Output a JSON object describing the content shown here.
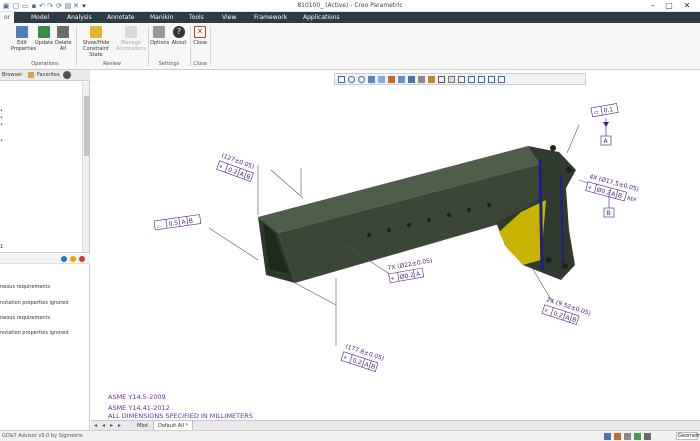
{
  "window": {
    "title": "810100_ (Active) - Creo Parametric"
  },
  "menu": {
    "tabs": [
      "or",
      "Model",
      "Analysis",
      "Annotate",
      "Manikin",
      "Tools",
      "View",
      "Framework",
      "Applications"
    ]
  },
  "ribbon": {
    "operations": {
      "buttons": [
        "Edit Properties",
        "Update",
        "Delete All"
      ],
      "label": "Operations"
    },
    "review": {
      "buttons": [
        "Show/Hide Constraint State",
        "Manage Annotations"
      ],
      "label": "Review"
    },
    "settings": {
      "buttons": [
        "Options",
        "About"
      ],
      "label": "Settings"
    },
    "close": {
      "buttons": [
        "Close"
      ],
      "label": "Close"
    }
  },
  "left_panel": {
    "tabs": [
      "Browser",
      "Favorites"
    ],
    "status_counts": [
      "1"
    ],
    "messages": [
      "neous requirements",
      "notation properties ignored",
      "neous requirements",
      "notation properties ignored"
    ]
  },
  "drawing": {
    "annotations": {
      "top_left_dim": "(127±0.05)",
      "top_left_fcf": [
        "⌖",
        "0.2",
        "A",
        "B",
        "M"
      ],
      "left_profile": [
        "⌓",
        "0.5",
        "A",
        "B",
        "M"
      ],
      "right_flatness": [
        "⏥",
        "0.1"
      ],
      "right_datum_a": "A",
      "hole_pattern_right": "4X (Ø17.5±0.05)",
      "hole_pattern_right_fcf": [
        "⌖",
        "Ø0.2",
        "A",
        "B",
        "M"
      ],
      "right_datum_b": "B",
      "ref": "REF",
      "mid_holes": "7X (Ø22±0.05)",
      "mid_holes_fcf": [
        "⌖",
        "Ø0.2",
        "A"
      ],
      "bottom_right_dim": "2X (9.52±0.05)",
      "bottom_right_fcf": [
        "⌖",
        "0.2",
        "A",
        "B",
        "M"
      ],
      "bottom_left_dim": "(177.8±0.05)",
      "bottom_left_fcf": [
        "⌖",
        "0.2",
        "A",
        "B",
        "M"
      ]
    },
    "notes": [
      "ASME Y14.5-2009",
      "ASME Y14.41-2012",
      "ALL DIMENSIONS SPECIFIED IN MILLIMETERS"
    ],
    "part_colors": {
      "body": "#3d4a3a",
      "accent": "#c8b400",
      "edge": "#1b1f8a"
    }
  },
  "sheets": {
    "tabs": [
      "Mbd",
      "Default All *"
    ]
  },
  "status": {
    "text": "GD&T Advisor v5.0 by Sigmetrix",
    "selector": "Geometry"
  }
}
